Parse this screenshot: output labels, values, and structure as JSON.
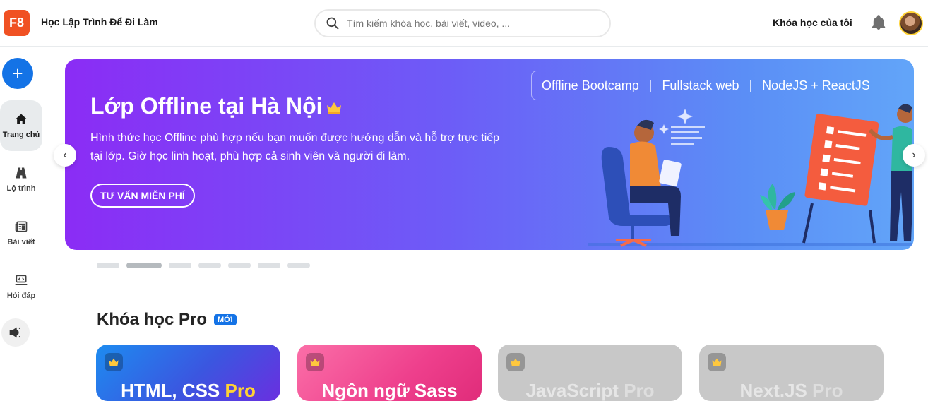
{
  "header": {
    "logo_text": "F8",
    "brand": "Học Lập Trình Để Đi Làm",
    "search_placeholder": "Tìm kiếm khóa học, bài viết, video, ...",
    "my_courses": "Khóa học của tôi"
  },
  "sidebar": {
    "add_label": "+",
    "items": [
      {
        "label": "Trang chủ",
        "icon": "home-icon",
        "active": true
      },
      {
        "label": "Lộ trình",
        "icon": "road-icon"
      },
      {
        "label": "Bài viết",
        "icon": "newspaper-icon"
      },
      {
        "label": "Hỏi đáp",
        "icon": "laptop-code-icon"
      }
    ],
    "extra_icon": "megaphone-icon"
  },
  "banner": {
    "title": "Lớp Offline tại Hà Nội",
    "description": "Hình thức học Offline phù hợp nếu bạn muốn được hướng dẫn và hỗ trợ trực tiếp tại lớp. Giờ học linh hoạt, phù hợp cả sinh viên và người đi làm.",
    "cta": "TƯ VẤN MIỄN PHÍ",
    "tags": [
      "Offline Bootcamp",
      "Fullstack web",
      "NodeJS + ReactJS"
    ],
    "sep": "|"
  },
  "carousel": {
    "prev": "‹",
    "next": "›",
    "dot_count": 7,
    "active_index": 1
  },
  "pro_section": {
    "title": "Khóa học Pro",
    "badge": "MỚI",
    "cards": [
      {
        "title": "HTML, CSS",
        "pro": "Pro"
      },
      {
        "title": "Ngôn ngữ Sass",
        "pro": ""
      },
      {
        "title": "JavaScript",
        "pro": "Pro"
      },
      {
        "title": "Next.JS",
        "pro": "Pro"
      }
    ]
  },
  "colors": {
    "brand": "#f05123",
    "accent": "#1473e6",
    "banner_start": "#8b2cf5",
    "banner_end": "#62a5f9"
  }
}
